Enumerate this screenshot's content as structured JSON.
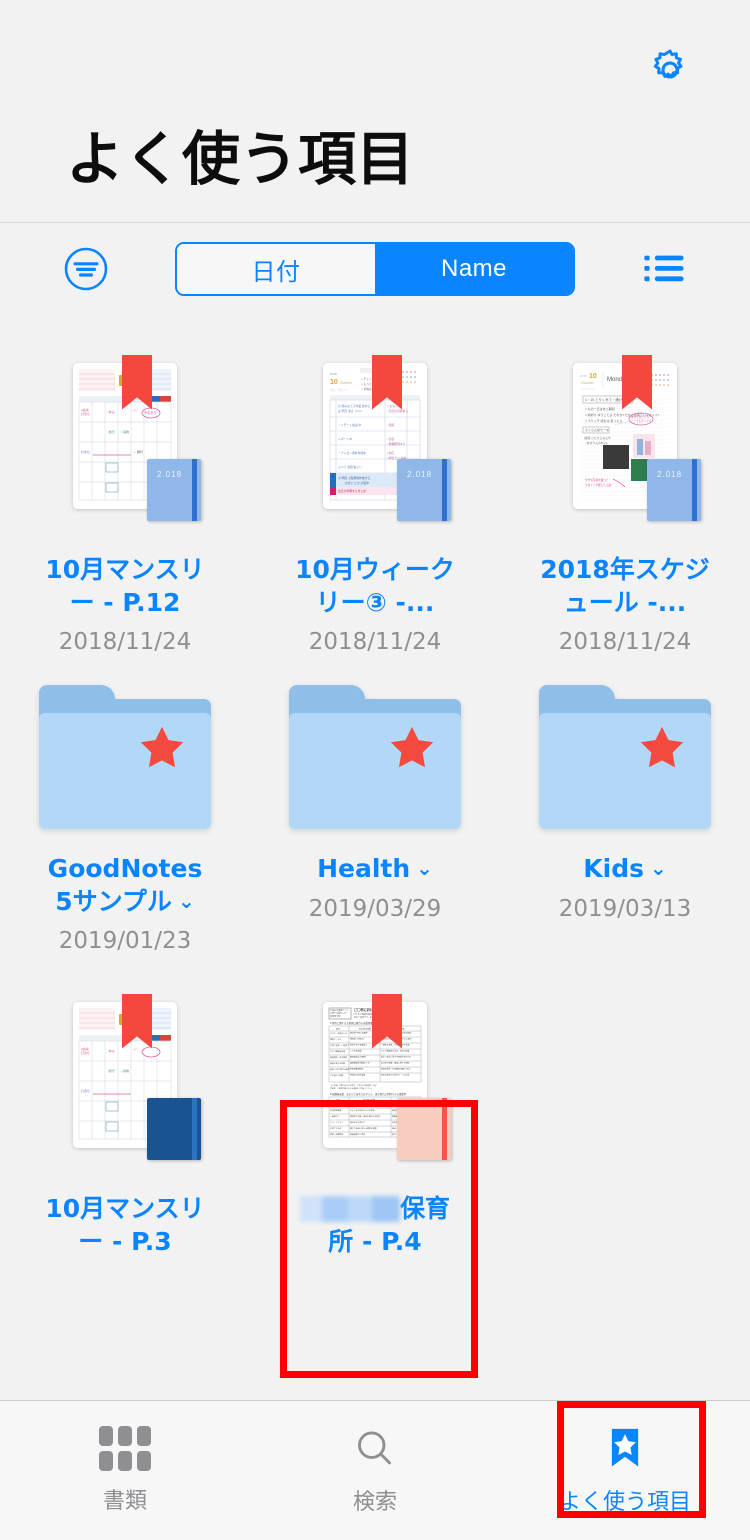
{
  "app": {
    "title": "よく使う項目",
    "background": "#f2f2f2",
    "accent": "#0a84ff",
    "annotation_color": "#ff0000"
  },
  "header": {
    "settings_icon": "gear-icon",
    "title": "よく使う項目"
  },
  "toolbar": {
    "filter_icon": "filter-lines-circle-icon",
    "listview_icon": "list-view-icon",
    "sort_segments": [
      {
        "label": "日付",
        "active": false
      },
      {
        "label": "Name",
        "active": true
      }
    ]
  },
  "grid": {
    "rows": [
      {
        "items": [
          {
            "kind": "document",
            "name": "10月マンスリー - P.12",
            "date": "2018/11/24",
            "ribbon_color": "#f4483f",
            "book_color": "#8fb8e8",
            "book_year": "2.018",
            "thumb": "monthly-calendar-thumbnail",
            "highlighted": false
          },
          {
            "kind": "document",
            "name": "10月ウィークリー③ -...",
            "date": "2018/11/24",
            "ribbon_color": "#f4483f",
            "book_color": "#8fb8e8",
            "book_year": "2.018",
            "thumb": "weekly-planner-thumbnail",
            "highlighted": false
          },
          {
            "kind": "document",
            "name": "2018年スケジュール -...",
            "date": "2018/11/24",
            "ribbon_color": "#f4483f",
            "book_color": "#8fb8e8",
            "book_year": "2.018",
            "thumb": "daily-journal-thumbnail",
            "highlighted": false
          }
        ]
      },
      {
        "items": [
          {
            "kind": "folder",
            "name": "GoodNotes 5サンプル",
            "date": "2019/01/23",
            "chevron": "⌄",
            "starred": true,
            "highlighted": false
          },
          {
            "kind": "folder",
            "name": "Health",
            "date": "2019/03/29",
            "chevron": "⌄",
            "starred": true,
            "highlighted": false
          },
          {
            "kind": "folder",
            "name": "Kids",
            "date": "2019/03/13",
            "chevron": "⌄",
            "starred": true,
            "highlighted": false
          }
        ]
      },
      {
        "items": [
          {
            "kind": "document",
            "name": "10月マンスリー - P.3",
            "date": "",
            "ribbon_color": "#f4483f",
            "book_color": "#1a5490",
            "book_year": "",
            "thumb": "monthly-calendar-thumbnail",
            "highlighted": false
          },
          {
            "kind": "document",
            "name_redacted_prefix": true,
            "name": "保育所 - P.4",
            "date": "",
            "ribbon_color": "#f4483f",
            "book_color": "#f8cdbf",
            "book_year": "",
            "thumb": "form-document-thumbnail",
            "highlighted": true
          }
        ]
      }
    ]
  },
  "tabbar": {
    "tabs": [
      {
        "label": "書類",
        "icon": "grid-icon",
        "active": false
      },
      {
        "label": "検索",
        "icon": "search-icon",
        "active": false
      },
      {
        "label": "よく使う項目",
        "icon": "bookmark-star-icon",
        "active": true
      }
    ]
  }
}
